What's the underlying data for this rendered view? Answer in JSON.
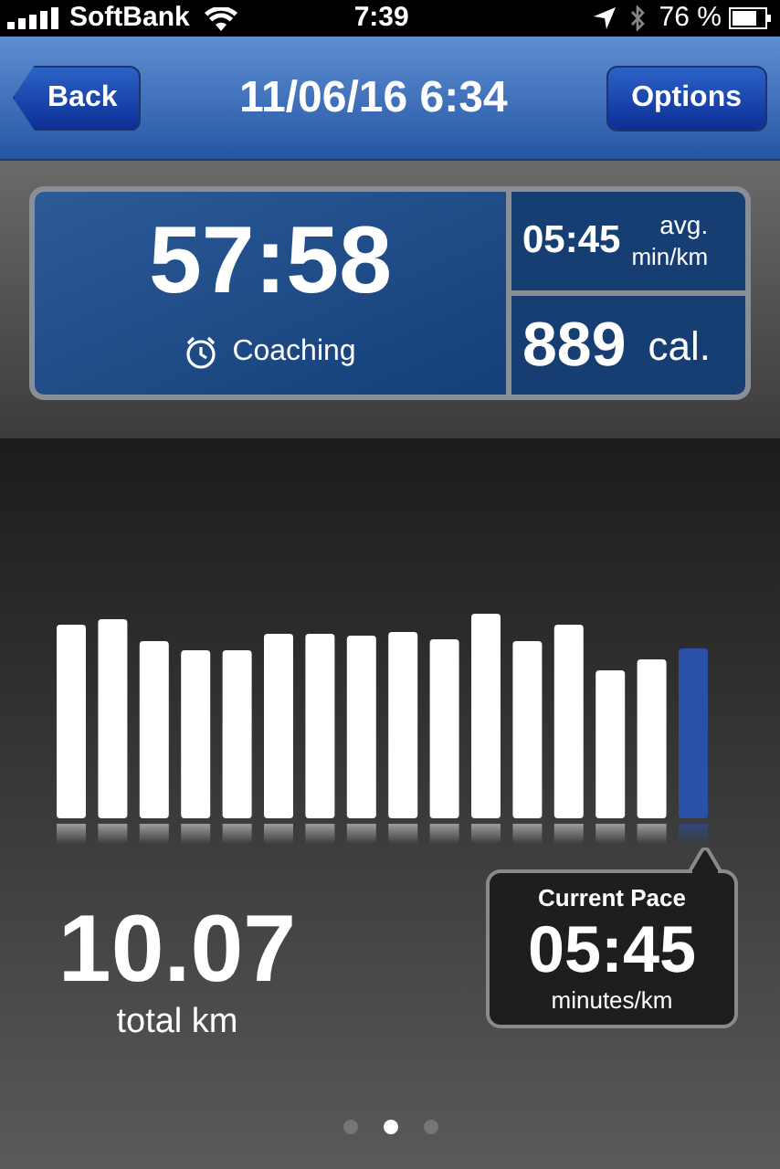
{
  "status_bar": {
    "carrier": "SoftBank",
    "time": "7:39",
    "battery": "76 %"
  },
  "nav_bar": {
    "back": "Back",
    "title": "11/06/16 6:34",
    "options": "Options"
  },
  "summary": {
    "duration": "57:58",
    "coaching": "Coaching",
    "avg_pace": "05:45",
    "avg_label": "avg.",
    "avg_unit": "min/km",
    "calories": "889",
    "calories_unit": "cal."
  },
  "distance": {
    "value": "10.07",
    "label": "total km"
  },
  "current_pace": {
    "title": "Current Pace",
    "value": "05:45",
    "unit": "minutes/km"
  },
  "page_dots": [
    {
      "selected": false
    },
    {
      "selected": true
    },
    {
      "selected": false
    }
  ]
}
